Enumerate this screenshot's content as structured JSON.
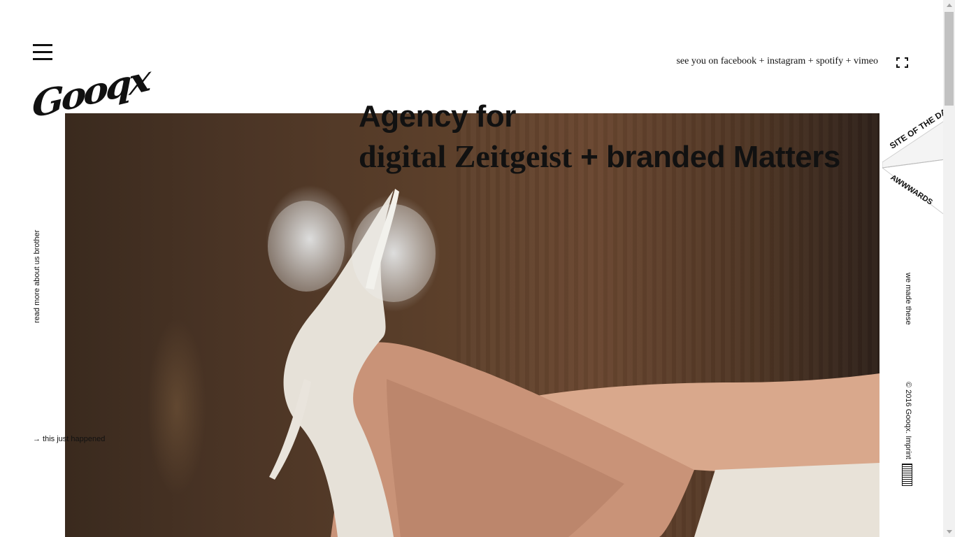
{
  "logo": {
    "text": "Gooqx"
  },
  "social": {
    "prefix": "see you on ",
    "links": [
      "facebook",
      "instagram",
      "spotify",
      "vimeo"
    ],
    "separator": " + "
  },
  "headline": {
    "line1": "Agency for",
    "line2_serif": "digital Zeitgeist",
    "line2_sans": " + branded Matters"
  },
  "side": {
    "about_link": "read more about us brother",
    "work_link": "we made these",
    "copyright": "© 2016 Gooqx. Imprint",
    "news_link": "→ this just happened"
  },
  "award": {
    "top": "SITE OF THE DAY",
    "bottom": "AWWWARDS",
    "accent": "#2a9d8f"
  },
  "icons": {
    "menu": "hamburger-icon",
    "fullscreen": "fullscreen-icon"
  },
  "colors": {
    "text": "#111111",
    "background": "#ffffff"
  }
}
